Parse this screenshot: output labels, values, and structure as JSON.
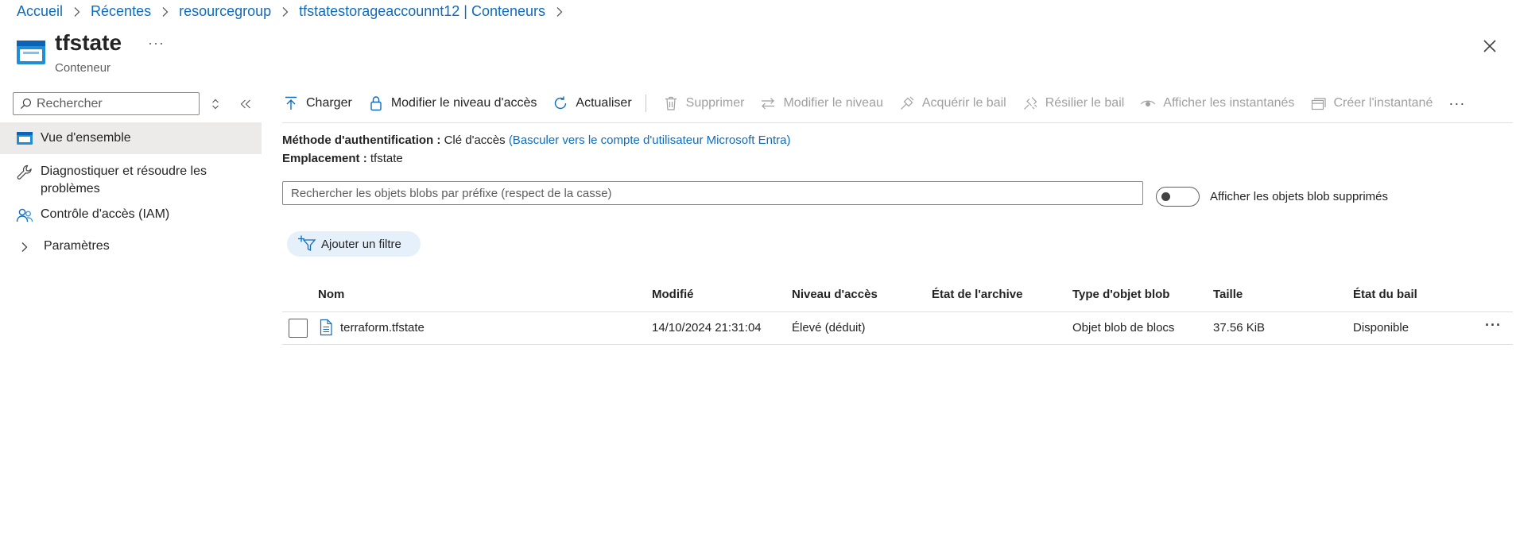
{
  "breadcrumb": {
    "items": [
      "Accueil",
      "Récentes",
      "resourcegroup",
      "tfstatestorageaccounnt12 | Conteneurs"
    ]
  },
  "header": {
    "title": "tfstate",
    "subtitle": "Conteneur",
    "more_label": "···"
  },
  "sidebar": {
    "search_placeholder": "Rechercher",
    "items": [
      {
        "label": "Vue d'ensemble",
        "icon": "container-icon",
        "selected": true
      },
      {
        "label": "Diagnostiquer et résoudre les problèmes",
        "icon": "wrench-icon"
      },
      {
        "label": "Contrôle d'accès (IAM)",
        "icon": "people-icon"
      },
      {
        "label": "Paramètres",
        "icon": "chevron-right-icon"
      }
    ]
  },
  "toolbar": {
    "upload": "Charger",
    "change_access_level": "Modifier le niveau d'accès",
    "refresh": "Actualiser",
    "delete": "Supprimer",
    "change_tier": "Modifier le niveau",
    "acquire_lease": "Acquérir le bail",
    "break_lease": "Résilier le bail",
    "view_snapshots": "Afficher les instantanés",
    "create_snapshot": "Créer l'instantané",
    "more_label": "···"
  },
  "info": {
    "auth_label": "Méthode d'authentification :",
    "auth_value": "Clé d'accès",
    "auth_link": "(Basculer vers le compte d'utilisateur Microsoft Entra)",
    "location_label": "Emplacement :",
    "location_value": "tfstate"
  },
  "filters": {
    "search_placeholder": "Rechercher les objets blobs par préfixe (respect de la casse)",
    "show_deleted_label": "Afficher les objets blob supprimés",
    "show_deleted_on": false,
    "add_filter_label": "Ajouter un filtre"
  },
  "table": {
    "columns": [
      "Nom",
      "Modifié",
      "Niveau d'accès",
      "État de l'archive",
      "Type d'objet blob",
      "Taille",
      "État du bail"
    ],
    "rows": [
      {
        "name": "terraform.tfstate",
        "modified": "14/10/2024 21:31:04",
        "access_tier": "Élevé (déduit)",
        "archive_status": "",
        "blob_type": "Objet blob de blocs",
        "size": "37.56 KiB",
        "lease_state": "Disponible",
        "more_label": "···"
      }
    ]
  },
  "colors": {
    "accent": "#0f6cbd",
    "selected_bg": "#edebe9",
    "filter_pill_bg": "#e5f0fb",
    "disabled_text": "#a19f9d",
    "container_icon": "#1f8ed6"
  }
}
